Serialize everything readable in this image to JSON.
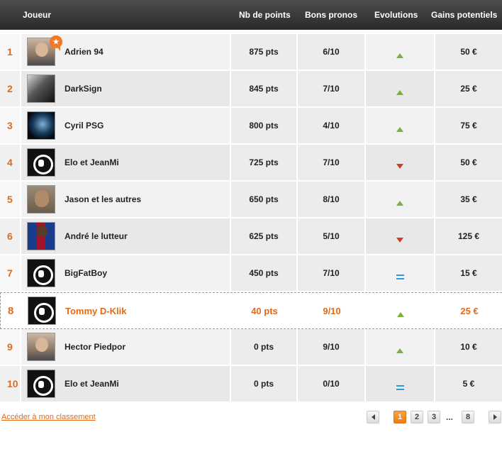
{
  "header": {
    "player": "Joueur",
    "points": "Nb de points",
    "bons": "Bons pronos",
    "evolutions": "Evolutions",
    "gains": "Gains potentiels"
  },
  "rows": [
    {
      "rank": "1",
      "name": "Adrien 94",
      "points": "875 pts",
      "bons": "6/10",
      "evolution": "up",
      "gains": "50 €",
      "avatar": "person",
      "badge": "trophy-icon"
    },
    {
      "rank": "2",
      "name": "DarkSign",
      "points": "845 pts",
      "bons": "7/10",
      "evolution": "up",
      "gains": "25 €",
      "avatar": "dark"
    },
    {
      "rank": "3",
      "name": "Cyril PSG",
      "points": "800 pts",
      "bons": "4/10",
      "evolution": "up",
      "gains": "75 €",
      "avatar": "blue"
    },
    {
      "rank": "4",
      "name": "Elo et JeanMi",
      "points": "725 pts",
      "bons": "7/10",
      "evolution": "down",
      "gains": "50 €",
      "avatar": "logo"
    },
    {
      "rank": "5",
      "name": "Jason et les autres",
      "points": "650 pts",
      "bons": "8/10",
      "evolution": "up",
      "gains": "35 €",
      "avatar": "face"
    },
    {
      "rank": "6",
      "name": "André le lutteur",
      "points": "625 pts",
      "bons": "5/10",
      "evolution": "down",
      "gains": "125 €",
      "avatar": "football"
    },
    {
      "rank": "7",
      "name": "BigFatBoy",
      "points": "450 pts",
      "bons": "7/10",
      "evolution": "equal",
      "gains": "15 €",
      "avatar": "logo"
    },
    {
      "rank": "8",
      "name": "Tommy D-Klik",
      "points": "40 pts",
      "bons": "9/10",
      "evolution": "up",
      "gains": "25 €",
      "avatar": "logo",
      "highlight": true
    },
    {
      "rank": "9",
      "name": "Hector Piedpor",
      "points": "0 pts",
      "bons": "9/10",
      "evolution": "up",
      "gains": "10 €",
      "avatar": "person"
    },
    {
      "rank": "10",
      "name": "Elo et JeanMi",
      "points": "0 pts",
      "bons": "0/10",
      "evolution": "equal",
      "gains": "5 €",
      "avatar": "logo"
    }
  ],
  "footer": {
    "link": "Accéder à mon classement"
  },
  "pagination": {
    "pages": [
      "1",
      "2",
      "3"
    ],
    "ellipsis": "...",
    "last": "8",
    "current": "1"
  },
  "colors": {
    "accent": "#e06a1a",
    "up": "#7ab23a",
    "down": "#d23a2a",
    "equal": "#2a9ad8"
  }
}
